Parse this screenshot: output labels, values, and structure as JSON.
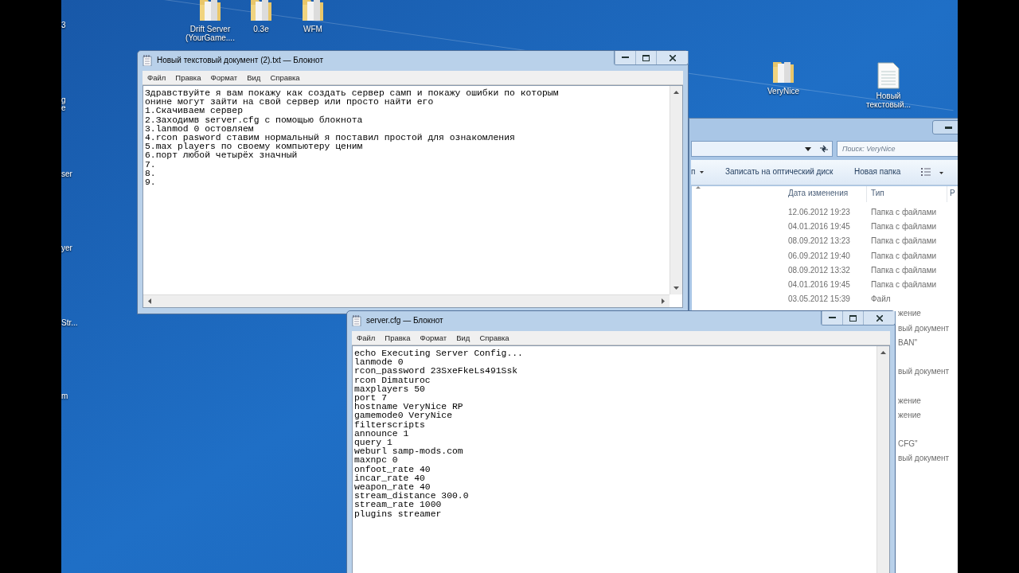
{
  "left_edge_labels": [
    "3",
    "g\ne",
    "ser",
    "yer",
    "Str...",
    "m"
  ],
  "desktop_icons": [
    {
      "label": "Drift Server\n(YourGame....",
      "kind": "folder"
    },
    {
      "label": "0.3e",
      "kind": "folder"
    },
    {
      "label": "WFM",
      "kind": "folder"
    },
    {
      "label": "VeryNice",
      "kind": "folder"
    },
    {
      "label": "Новый\nтекстовый...",
      "kind": "document"
    }
  ],
  "explorer": {
    "search_placeholder": "Поиск: VeryNice",
    "toolbar": [
      "п",
      "Записать на оптический диск",
      "Новая папка"
    ],
    "columns": [
      "Дата изменения",
      "Тип",
      "Р"
    ],
    "rows": [
      {
        "date": "12.06.2012 19:23",
        "type": "Папка с файлами"
      },
      {
        "date": "04.01.2016 19:45",
        "type": "Папка с файлами"
      },
      {
        "date": "08.09.2012 13:23",
        "type": "Папка с файлами"
      },
      {
        "date": "06.09.2012 19:40",
        "type": "Папка с файлами"
      },
      {
        "date": "08.09.2012 13:32",
        "type": "Папка с файлами"
      },
      {
        "date": "04.01.2016 19:45",
        "type": "Папка с файлами"
      },
      {
        "date": "03.05.2012 15:39",
        "type": "Файл"
      }
    ],
    "cut_rows": [
      "жение",
      "вый документ",
      "BAN\"",
      "вый документ",
      "жение",
      "жение",
      "CFG\"",
      "вый документ"
    ]
  },
  "notepads": [
    {
      "title": "Новый текстовый документ (2).txt — Блокнот",
      "menu": [
        "Файл",
        "Правка",
        "Формат",
        "Вид",
        "Справка"
      ],
      "lines": [
        "Здравствуйте я вам покажу как создать сервер самп и покажу ошибки по которым",
        "онине могут зайти на свой сервер или просто найти его",
        "1.Скачиваем сервер",
        "2.Заходимв server.cfg с помощью блокнота",
        "3.lanmod 0 остовляем",
        "4.rcon pasword ставим нормальный я поставил простой для ознакомления",
        "5.max players по своему компьютеру ценим",
        "6.порт любой четырёх значный",
        "7.",
        "8.",
        "9."
      ]
    },
    {
      "title": "server.cfg — Блокнот",
      "menu": [
        "Файл",
        "Правка",
        "Формат",
        "Вид",
        "Справка"
      ],
      "lines": [
        "echo Executing Server Config...",
        "lanmode 0",
        "rcon_password 23SxeFkeLs491Ssk",
        "rcon Dimaturoc",
        "maxplayers 50",
        "port 7",
        "hostname VeryNice RP",
        "gamemode0 VeryNice",
        "filterscripts",
        "announce 1",
        "query 1",
        "weburl samp-mods.com",
        "maxnpc 0",
        "onfoot_rate 40",
        "incar_rate 40",
        "weapon_rate 40",
        "stream_distance 300.0",
        "stream_rate 1000",
        "plugins streamer"
      ]
    }
  ]
}
